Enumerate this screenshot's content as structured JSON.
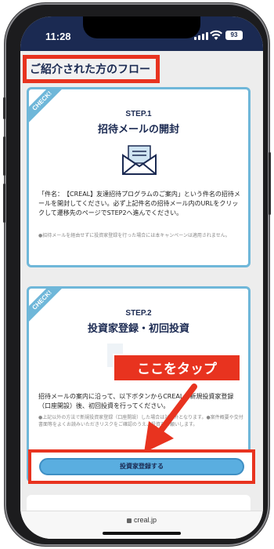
{
  "status_bar": {
    "time": "11:28",
    "battery": "93"
  },
  "page": {
    "title": "ご紹介された方のフロー"
  },
  "step1": {
    "check": "CHECK!",
    "label": "STEP.1",
    "title": "招待メールの開封",
    "icon": "envelope-icon",
    "text": "「件名：　【CREAL】友達招待プログラムのご案内」という件名の招待メールを開封してください。必ず上記件名の招待メール内のURLをクリックして遷移先のページでSTEP2へ進んでください。",
    "note": "●招待メールを経由せずに投資家登録を行った場合には本キャンペーンは適用されません。"
  },
  "step2": {
    "check": "CHECK!",
    "label": "STEP.2",
    "title": "投資家登録・初回投資",
    "text": "招待メールの案内に沿って、以下ボタンからCREALへ新規投資家登録（口座開設）後、初回投資を行ってください。",
    "note": "●上記以外の方法で新規投資家登録（口座開設）した場合は対象外となります。●案件概要や交付書面等をよくお読みいただきリスクをご確認のうえ、投資をお願いします。",
    "cta": "投資家登録する"
  },
  "callout": {
    "text": "ここをタップ"
  },
  "browser": {
    "url": "creal.jp"
  },
  "colors": {
    "accent_red": "#e8331f",
    "navy": "#1b2a52",
    "card_border": "#6fb7d9",
    "button": "#5aaee0"
  }
}
